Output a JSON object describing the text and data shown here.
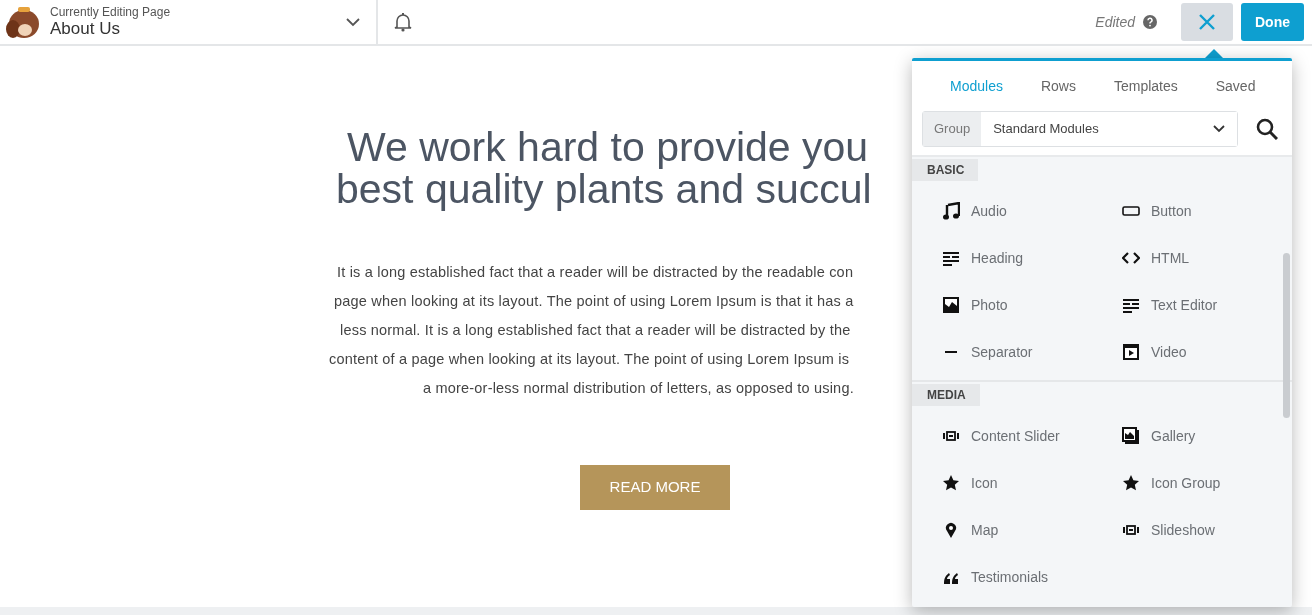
{
  "top_bar": {
    "subtitle": "Currently Editing Page",
    "page_title": "About Us",
    "status": "Edited",
    "done_button": "Done"
  },
  "page": {
    "heading_lines": [
      "We work hard to provide you",
      "best quality plants and succul"
    ],
    "paragraph_lines": [
      "It is a long established fact that a reader will be distracted by the readable con",
      "page when looking at its layout. The point of using Lorem Ipsum is that it has a",
      "less normal. It is a long established fact that a reader will be distracted by the",
      "content of a page when looking at its layout. The point of using Lorem Ipsum is",
      "a more-or-less normal distribution of letters, as opposed to using."
    ],
    "button": "READ MORE"
  },
  "panel": {
    "tabs": [
      {
        "label": "Modules",
        "selected": true
      },
      {
        "label": "Rows",
        "selected": false
      },
      {
        "label": "Templates",
        "selected": false
      },
      {
        "label": "Saved",
        "selected": false
      }
    ],
    "group_label": "Group",
    "group_value": "Standard Modules",
    "sections": [
      {
        "title": "BASIC",
        "modules": [
          {
            "label": "Audio",
            "kind": "music"
          },
          {
            "label": "Button",
            "kind": "button"
          },
          {
            "label": "Heading",
            "kind": "lines"
          },
          {
            "label": "HTML",
            "kind": "code"
          },
          {
            "label": "Photo",
            "kind": "photo"
          },
          {
            "label": "Text Editor",
            "kind": "lines"
          },
          {
            "label": "Separator",
            "kind": "dash"
          },
          {
            "label": "Video",
            "kind": "video"
          }
        ]
      },
      {
        "title": "MEDIA",
        "modules": [
          {
            "label": "Content Slider",
            "kind": "slider"
          },
          {
            "label": "Gallery",
            "kind": "gallery"
          },
          {
            "label": "Icon",
            "kind": "star"
          },
          {
            "label": "Icon Group",
            "kind": "star"
          },
          {
            "label": "Map",
            "kind": "pin"
          },
          {
            "label": "Slideshow",
            "kind": "slider"
          },
          {
            "label": "Testimonials",
            "kind": "quote"
          }
        ]
      }
    ]
  }
}
